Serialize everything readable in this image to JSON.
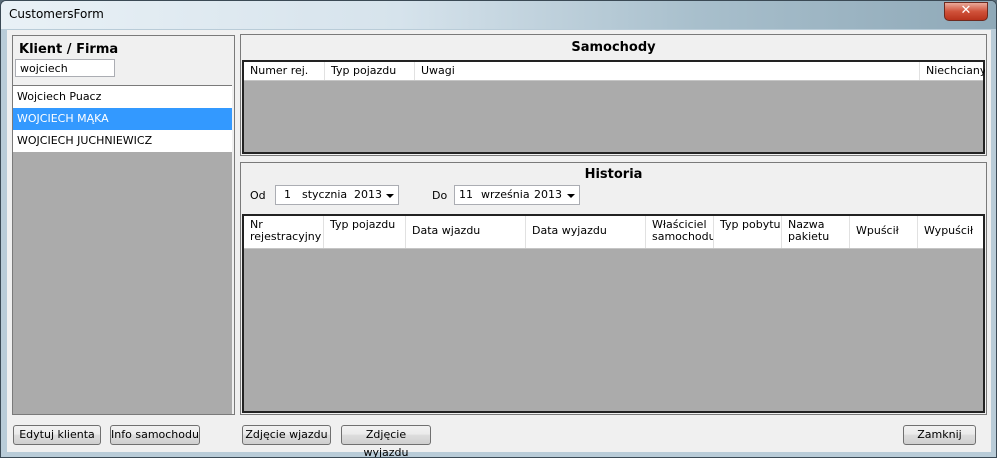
{
  "window": {
    "title": "CustomersForm",
    "close_glyph": "✕"
  },
  "clients": {
    "heading": "Klient / Firma",
    "search_value": "wojciech",
    "items": [
      {
        "label": "Wojciech Puacz",
        "selected": false
      },
      {
        "label": "WOJCIECH MĄKA",
        "selected": true
      },
      {
        "label": "WOJCIECH JUCHNIEWICZ",
        "selected": false
      }
    ]
  },
  "cars": {
    "title": "Samochody",
    "columns": [
      "Numer rej.",
      "Typ pojazdu",
      "Uwagi",
      "Niechciany"
    ]
  },
  "history": {
    "title": "Historia",
    "from_label": "Od",
    "from_date": {
      "day": "1",
      "month": "stycznia",
      "year": "2013"
    },
    "to_label": "Do",
    "to_date": {
      "day": "11",
      "month": "września",
      "year": "2013"
    },
    "columns": [
      "Nr rejestracyjny",
      "Typ pojazdu",
      "Data wjazdu",
      "Data wyjazdu",
      "Właściciel samochodu",
      "Typ pobytu",
      "Nazwa pakietu",
      "Wpuścił",
      "Wypuścił"
    ]
  },
  "buttons": {
    "edit_client": "Edytuj klienta",
    "car_info": "Info samochodu",
    "entry_photo": "Zdjęcie wjazdu",
    "exit_photo": "Zdjęcie wyjazdu",
    "close": "Zamknij"
  },
  "colors": {
    "selection": "#3399ff",
    "grid_empty": "#ababab"
  }
}
